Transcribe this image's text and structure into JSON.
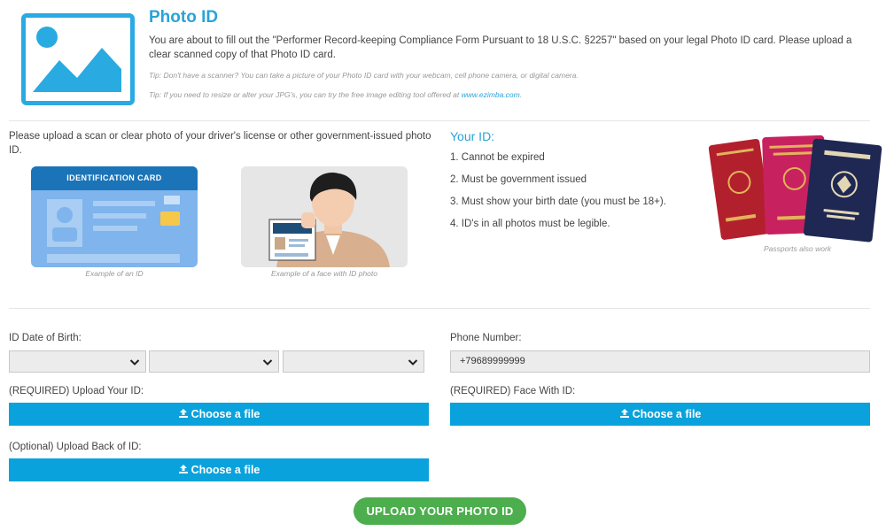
{
  "header": {
    "title": "Photo ID",
    "intro": "You are about to fill out the \"Performer Record-keeping Compliance Form Pursuant to 18 U.S.C. §2257\" based on your legal Photo ID card. Please upload a clear scanned copy of that Photo ID card.",
    "tip1": "Tip: Don't have a scanner? You can take a picture of your Photo ID card with your webcam, cell phone camera, or digital camera.",
    "tip2_prefix": "Tip: If you need to resize or alter your JPG's, you can try the free image editing tool offered at ",
    "tip2_link": "www.ezimba.com",
    "tip2_suffix": "."
  },
  "examples": {
    "instructions": "Please upload a scan or clear photo of your driver's license or other government-issued photo ID.",
    "id_card_label": "IDENTIFICATION CARD",
    "id_caption": "Example of an ID",
    "face_caption": "Example of a face with ID photo",
    "passports_caption": "Passports also work"
  },
  "your_id": {
    "title": "Your ID:",
    "requirements": [
      "1. Cannot be expired",
      "2. Must be government issued",
      "3. Must show your birth date (you must be 18+).",
      "4. ID's in all photos must be legible."
    ]
  },
  "form": {
    "dob_label": "ID Date of Birth:",
    "phone_label": "Phone Number:",
    "phone_value": "+79689999999",
    "upload_id_label": "(REQUIRED) Upload Your ID:",
    "face_label": "(REQUIRED) Face With ID:",
    "back_label": "(Optional) Upload Back of ID:",
    "choose_file": "Choose a file",
    "submit": "UPLOAD YOUR PHOTO ID"
  },
  "icons": {
    "header": "image-icon",
    "upload": "upload-icon",
    "select": "chevron-down-icon"
  },
  "colors": {
    "accent": "#29a3d8",
    "button": "#0aa2dc",
    "submit": "#4cae4c"
  }
}
